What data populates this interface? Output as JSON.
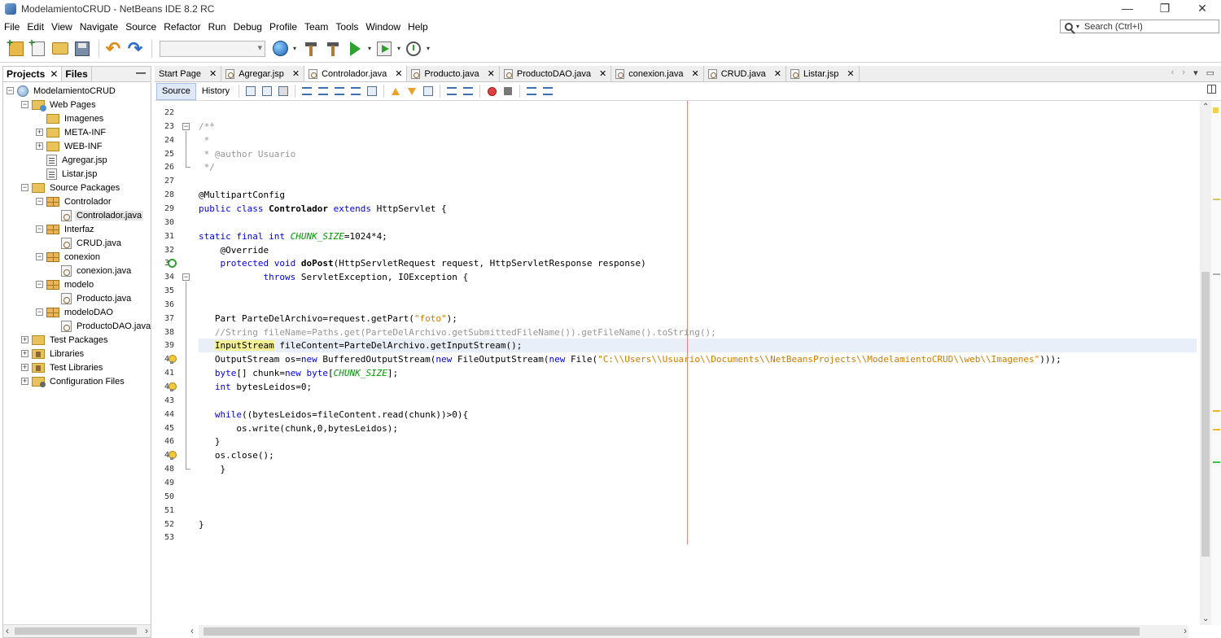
{
  "window": {
    "title": "ModelamientoCRUD - NetBeans IDE 8.2 RC",
    "minimize_glyph": "—",
    "maximize_glyph": "❐",
    "close_glyph": "✕"
  },
  "menu": [
    "File",
    "Edit",
    "View",
    "Navigate",
    "Source",
    "Refactor",
    "Run",
    "Debug",
    "Profile",
    "Team",
    "Tools",
    "Window",
    "Help"
  ],
  "search": {
    "placeholder": "Search (Ctrl+I)"
  },
  "toolbar": {
    "icons": [
      "new-project-icon",
      "new-file-icon",
      "open-project-icon",
      "save-all-icon",
      "undo-icon",
      "redo-icon",
      "run-config-select",
      "browser-icon",
      "build-icon",
      "clean-build-icon",
      "run-icon",
      "debug-icon",
      "profile-icon"
    ]
  },
  "left_panel": {
    "tabs": [
      "Projects",
      "Files"
    ],
    "close_glyph": "✕",
    "minimize_glyph": "—",
    "tree": [
      {
        "label": "ModelamientoCRUD",
        "icon": "project-icon",
        "depth": 0,
        "expander": "−"
      },
      {
        "label": "Web Pages",
        "icon": "webfolder-icon",
        "depth": 1,
        "expander": "−"
      },
      {
        "label": "Imagenes",
        "icon": "folder-icon",
        "depth": 2,
        "expander": ""
      },
      {
        "label": "META-INF",
        "icon": "folder-icon",
        "depth": 2,
        "expander": "+"
      },
      {
        "label": "WEB-INF",
        "icon": "folder-icon",
        "depth": 2,
        "expander": "+"
      },
      {
        "label": "Agregar.jsp",
        "icon": "jsp-icon",
        "depth": 2,
        "expander": ""
      },
      {
        "label": "Listar.jsp",
        "icon": "jsp-icon",
        "depth": 2,
        "expander": ""
      },
      {
        "label": "Source Packages",
        "icon": "folder-icon",
        "depth": 1,
        "expander": "−"
      },
      {
        "label": "Controlador",
        "icon": "package-icon",
        "depth": 2,
        "expander": "−"
      },
      {
        "label": "Controlador.java",
        "icon": "java-icon",
        "depth": 3,
        "expander": "",
        "selected": true
      },
      {
        "label": "Interfaz",
        "icon": "package-icon",
        "depth": 2,
        "expander": "−"
      },
      {
        "label": "CRUD.java",
        "icon": "java-icon",
        "depth": 3,
        "expander": ""
      },
      {
        "label": "conexion",
        "icon": "package-icon",
        "depth": 2,
        "expander": "−"
      },
      {
        "label": "conexion.java",
        "icon": "java-icon",
        "depth": 3,
        "expander": ""
      },
      {
        "label": "modelo",
        "icon": "package-icon",
        "depth": 2,
        "expander": "−"
      },
      {
        "label": "Producto.java",
        "icon": "java-icon",
        "depth": 3,
        "expander": ""
      },
      {
        "label": "modeloDAO",
        "icon": "package-icon",
        "depth": 2,
        "expander": "−"
      },
      {
        "label": "ProductoDAO.java",
        "icon": "java-icon",
        "depth": 3,
        "expander": ""
      },
      {
        "label": "Test Packages",
        "icon": "folder-icon",
        "depth": 1,
        "expander": "+"
      },
      {
        "label": "Libraries",
        "icon": "library-icon",
        "depth": 1,
        "expander": "+"
      },
      {
        "label": "Test Libraries",
        "icon": "library-icon",
        "depth": 1,
        "expander": "+"
      },
      {
        "label": "Configuration Files",
        "icon": "config-icon",
        "depth": 1,
        "expander": "+"
      }
    ]
  },
  "editor_tabs": [
    {
      "label": "Start Page",
      "icon": false,
      "active": false
    },
    {
      "label": "Agregar.jsp",
      "icon": true,
      "active": false
    },
    {
      "label": "Controlador.java",
      "icon": true,
      "active": true
    },
    {
      "label": "Producto.java",
      "icon": true,
      "active": false
    },
    {
      "label": "ProductoDAO.java",
      "icon": true,
      "active": false
    },
    {
      "label": "conexion.java",
      "icon": true,
      "active": false
    },
    {
      "label": "CRUD.java",
      "icon": true,
      "active": false
    },
    {
      "label": "Listar.jsp",
      "icon": true,
      "active": false
    }
  ],
  "tab_close_glyph": "✕",
  "editor_subtabs": {
    "source": "Source",
    "history": "History"
  },
  "editor": {
    "current_line": 39,
    "code_lines": [
      {
        "n": 22,
        "html": ""
      },
      {
        "n": 23,
        "html": "<span class=\"cm\">/**</span>"
      },
      {
        "n": 24,
        "html": "<span class=\"cm\"> *</span>"
      },
      {
        "n": 25,
        "html": "<span class=\"cm\"> * @author Usuario</span>"
      },
      {
        "n": 26,
        "html": "<span class=\"cm\"> */</span>"
      },
      {
        "n": 27,
        "html": ""
      },
      {
        "n": 28,
        "html": "@MultipartConfig"
      },
      {
        "n": 29,
        "html": "<span class=\"k\">public class</span> <span class=\"b\">Controlador</span> <span class=\"k\">extends</span> HttpServlet {"
      },
      {
        "n": 30,
        "html": ""
      },
      {
        "n": 31,
        "html": "<span class=\"k\">static final int</span> <span class=\"ci\">CHUNK_SIZE</span>=1024*4;"
      },
      {
        "n": 32,
        "html": "    @Override"
      },
      {
        "n": 33,
        "html": "    <span class=\"k\">protected void</span> <span class=\"b\">doPost</span>(HttpServletRequest request, HttpServletResponse response)"
      },
      {
        "n": 34,
        "html": "            <span class=\"k\">throws</span> ServletException, IOException {"
      },
      {
        "n": 35,
        "html": ""
      },
      {
        "n": 36,
        "html": ""
      },
      {
        "n": 37,
        "html": "   Part ParteDelArchivo=request.getPart(<span class=\"s\">\"foto\"</span>);"
      },
      {
        "n": 38,
        "html": "   <span class=\"cm\">//String fileName=Paths.get(ParteDelArchivo.getSubmittedFileName()).getFileName().toString();</span>"
      },
      {
        "n": 39,
        "html": "   <span class=\"mark\">InputStream</span> fileContent=ParteDelArchivo.getInputStream();"
      },
      {
        "n": 40,
        "html": "   OutputStream os=<span class=\"k\">new</span> BufferedOutputStream(<span class=\"k\">new</span> FileOutputStream(<span class=\"k\">new</span> File(<span class=\"s\">\"C:\\\\Users\\\\Usuario\\\\Documents\\\\NetBeansProjects\\\\ModelamientoCRUD\\\\web\\\\Imagenes\"</span>)));"
      },
      {
        "n": 41,
        "html": "   <span class=\"k\">byte</span>[] chunk=<span class=\"k\">new byte</span>[<span class=\"ci\">CHUNK_SIZE</span>];"
      },
      {
        "n": 42,
        "html": "   <span class=\"k\">int</span> bytesLeidos=0;"
      },
      {
        "n": 43,
        "html": ""
      },
      {
        "n": 44,
        "html": "   <span class=\"k\">while</span>((bytesLeidos=fileContent.read(chunk))>0){"
      },
      {
        "n": 45,
        "html": "       os.write(chunk,0,bytesLeidos);"
      },
      {
        "n": 46,
        "html": "   }"
      },
      {
        "n": 47,
        "html": "   os.close();"
      },
      {
        "n": 48,
        "html": "    }"
      },
      {
        "n": 49,
        "html": ""
      },
      {
        "n": 50,
        "html": ""
      },
      {
        "n": 51,
        "html": ""
      },
      {
        "n": 52,
        "html": "}"
      },
      {
        "n": 53,
        "html": ""
      }
    ],
    "gutter_markers": [
      {
        "line": 33,
        "icon": "override-icon"
      },
      {
        "line": 40,
        "icon": "hint-bulb-icon"
      },
      {
        "line": 42,
        "icon": "hint-bulb-icon"
      },
      {
        "line": 47,
        "icon": "hint-bulb-icon"
      }
    ]
  },
  "error_stripe": {
    "marks": [
      {
        "color": "#d2c66a"
      },
      {
        "color": "#b0b0b0"
      },
      {
        "color": "#f0b42a"
      },
      {
        "color": "#f0b42a"
      },
      {
        "color": "#3fbf3f"
      }
    ]
  }
}
